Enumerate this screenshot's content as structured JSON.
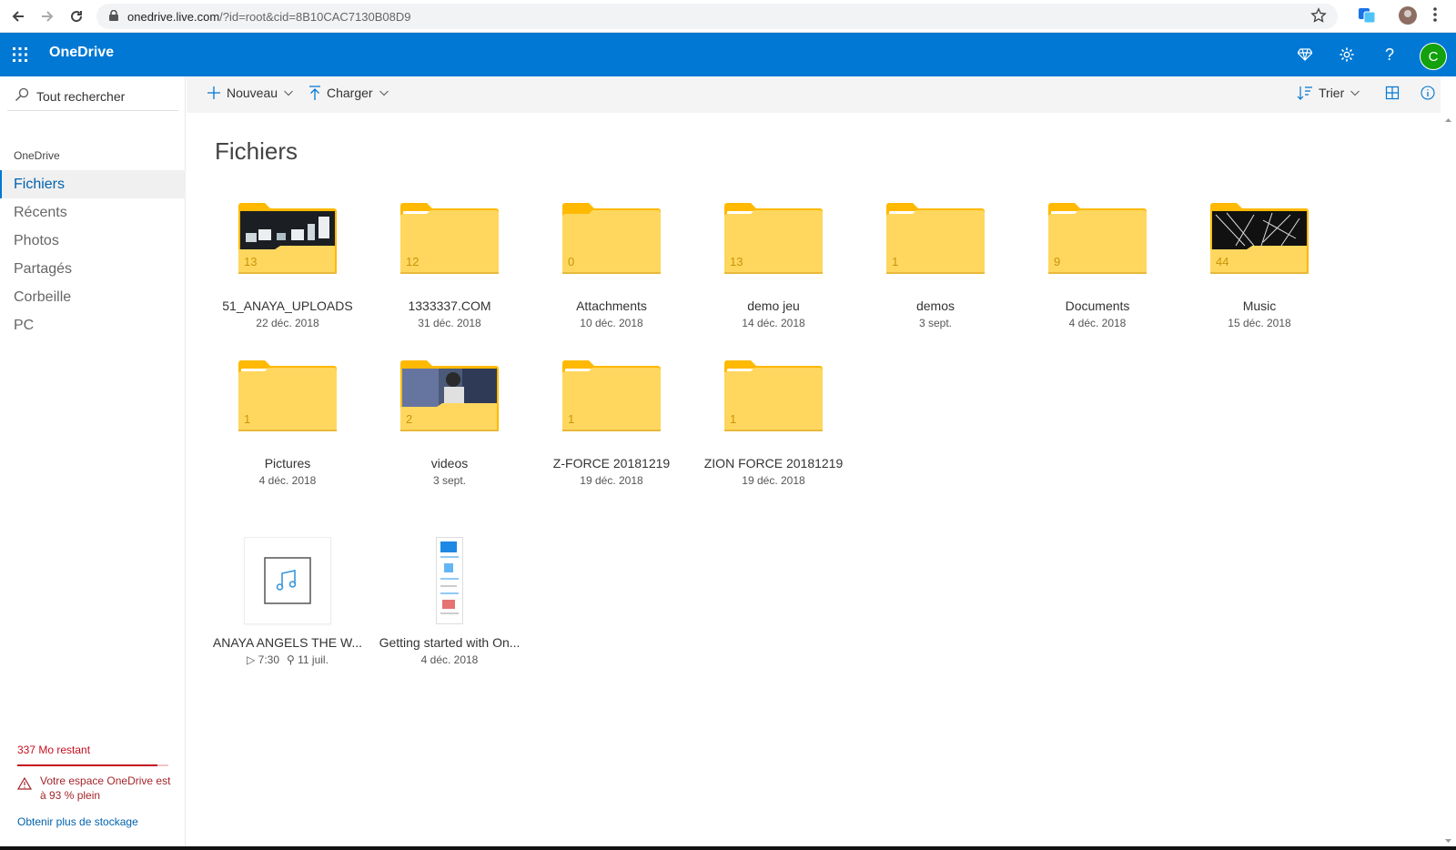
{
  "browser": {
    "url_host": "onedrive.live.com",
    "url_rest": "/?id=root&cid=8B10CAC7130B08D9"
  },
  "header": {
    "app_name": "OneDrive",
    "avatar_letter": "C"
  },
  "sidebar": {
    "search_placeholder": "Tout rechercher",
    "section_label": "OneDrive",
    "items": [
      {
        "label": "Fichiers",
        "active": true
      },
      {
        "label": "Récents"
      },
      {
        "label": "Photos"
      },
      {
        "label": "Partagés"
      },
      {
        "label": "Corbeille"
      },
      {
        "label": "PC"
      }
    ],
    "storage": {
      "remaining": "337 Mo restant",
      "used_fraction": 0.93,
      "warning": "Votre espace OneDrive est à 93 % plein",
      "more_link": "Obtenir plus de stockage"
    }
  },
  "commands": {
    "new": "Nouveau",
    "upload": "Charger",
    "sort": "Trier"
  },
  "main": {
    "title": "Fichiers",
    "folders": [
      {
        "name": "51_ANAYA_UPLOADS",
        "count": "13",
        "date": "22 déc. 2018",
        "thumb": "dark"
      },
      {
        "name": "1333337.COM",
        "count": "12",
        "date": "31 déc. 2018"
      },
      {
        "name": "Attachments",
        "count": "0",
        "date": "10 déc. 2018",
        "empty": true
      },
      {
        "name": "demo jeu",
        "count": "13",
        "date": "14 déc. 2018"
      },
      {
        "name": "demos",
        "count": "1",
        "date": "3 sept."
      },
      {
        "name": "Documents",
        "count": "9",
        "date": "4 déc. 2018"
      },
      {
        "name": "Music",
        "count": "44",
        "date": "15 déc. 2018",
        "thumb": "web"
      },
      {
        "name": "Pictures",
        "count": "1",
        "date": "4 déc. 2018"
      },
      {
        "name": "videos",
        "count": "2",
        "date": "3 sept.",
        "thumb": "photo"
      },
      {
        "name": "Z-FORCE 20181219",
        "count": "1",
        "date": "19 déc. 2018"
      },
      {
        "name": "ZION FORCE 20181219",
        "count": "1",
        "date": "19 déc. 2018"
      }
    ],
    "files": [
      {
        "name": "ANAYA ANGELS THE W...",
        "duration": "7:30",
        "date": "11 juil.",
        "type": "audio"
      },
      {
        "name": "Getting started with On...",
        "date": "4 déc. 2018",
        "type": "document"
      }
    ]
  },
  "colors": {
    "brand": "#0078d4",
    "folder": "#ffd75e",
    "folder_tab": "#ffb900",
    "warning": "#c50f1f",
    "avatar": "#13a10e"
  }
}
